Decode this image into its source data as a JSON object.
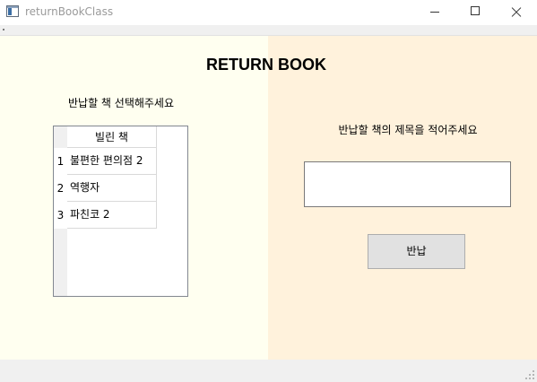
{
  "window": {
    "title": "returnBookClass",
    "icon": "app-window-icon"
  },
  "page": {
    "heading": "RETURN BOOK",
    "left_instruction": "반납할 책 선택해주세요",
    "right_instruction": "반납할 책의 제목을 적어주세요"
  },
  "grid": {
    "column_header": "빌린 책",
    "rows": [
      {
        "num": "1",
        "title": "불편한 편의점 2"
      },
      {
        "num": "2",
        "title": "역행자"
      },
      {
        "num": "3",
        "title": "파친코 2"
      }
    ]
  },
  "title_input": {
    "value": "",
    "placeholder": ""
  },
  "return_button": {
    "label": "반납"
  },
  "colors": {
    "left_panel_bg": "#fffff0",
    "right_panel_bg": "#fff2dc",
    "button_bg": "#e1e1e1"
  }
}
